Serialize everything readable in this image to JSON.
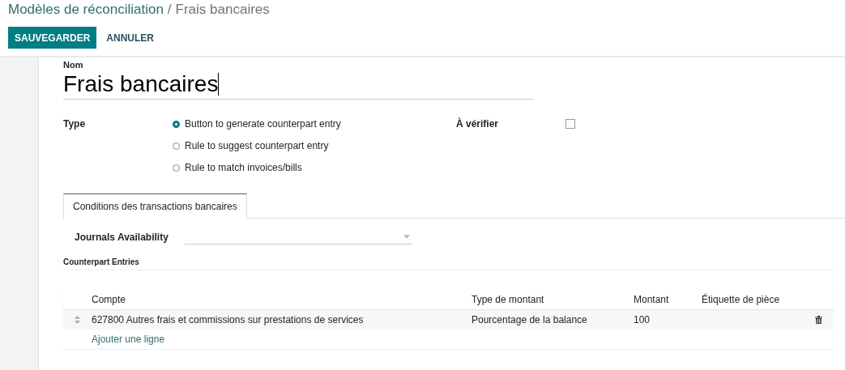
{
  "breadcrumb": {
    "parent": "Modèles de réconciliation",
    "separator": "/",
    "current": "Frais bancaires"
  },
  "buttons": [
    {
      "label": "SAUVEGARDER",
      "kind": "primary"
    },
    {
      "label": "ANNULER",
      "kind": "secondary"
    }
  ],
  "name_field": {
    "label": "Nom",
    "value": "Frais bancaires"
  },
  "type_field": {
    "label": "Type",
    "options": [
      {
        "label": "Button to generate counterpart entry",
        "selected": true
      },
      {
        "label": "Rule to suggest counterpart entry",
        "selected": false
      },
      {
        "label": "Rule to match invoices/bills",
        "selected": false
      }
    ]
  },
  "to_check": {
    "label": "À vérifier",
    "checked": false
  },
  "tabs": [
    {
      "label": "Conditions des transactions bancaires",
      "selected": true
    }
  ],
  "journals": {
    "label": "Journals Availability"
  },
  "section_title": "Counterpart Entries",
  "table": {
    "columns": [
      "Compte",
      "Type de montant",
      "Montant",
      "Étiquette de pièce"
    ],
    "rows": [
      [
        "627800 Autres frais et commissions sur prestations de services",
        "Pourcentage de la balance",
        "100",
        ""
      ]
    ],
    "add_line": "Ajouter une ligne"
  }
}
